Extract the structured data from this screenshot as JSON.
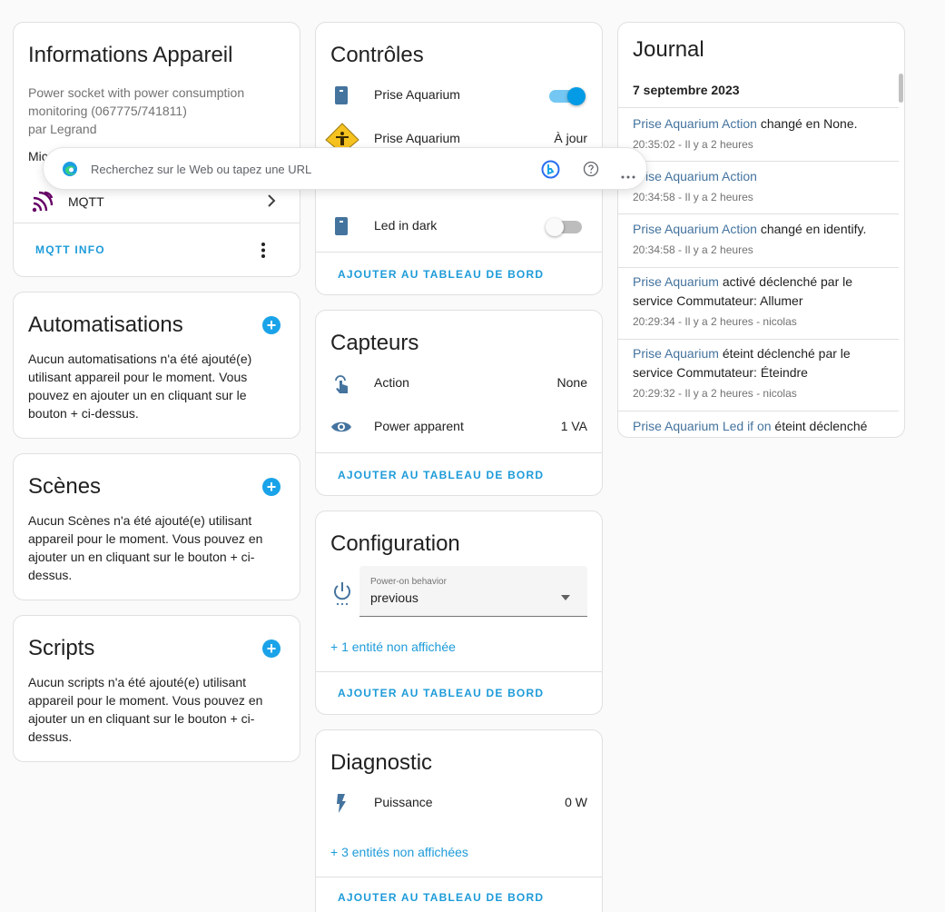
{
  "device_info": {
    "title": "Informations Appareil",
    "line1": "Power socket with power consumption",
    "line2": "monitoring (067775/741811)",
    "line3": "par Legrand",
    "partial": "Mic",
    "integration_label": "MQTT",
    "action": "MQTT INFO"
  },
  "automations": {
    "title": "Automatisations",
    "text": "Aucun automatisations n'a été ajouté(e) utilisant appareil pour le moment. Vous pouvez en ajouter un en cliquant sur le bouton + ci-dessus."
  },
  "scenes": {
    "title": "Scènes",
    "text": "Aucun Scènes n'a été ajouté(e) utilisant appareil pour le moment. Vous pouvez en ajouter un en cliquant sur le bouton + ci-dessus."
  },
  "scripts": {
    "title": "Scripts",
    "text": "Aucun scripts n'a été ajouté(e) utilisant appareil pour le moment. Vous pouvez en ajouter un en cliquant sur le bouton + ci-dessus."
  },
  "controls": {
    "title": "Contrôles",
    "rows": [
      {
        "name": "Prise Aquarium",
        "state": "on"
      },
      {
        "name": "Prise Aquarium",
        "value": "À jour"
      },
      {
        "name": "Led in dark",
        "state": "off"
      }
    ],
    "action": "AJOUTER AU TABLEAU DE BORD"
  },
  "sensors": {
    "title": "Capteurs",
    "rows": [
      {
        "name": "Action",
        "value": "None"
      },
      {
        "name": "Power apparent",
        "value": "1 VA"
      }
    ],
    "action": "AJOUTER AU TABLEAU DE BORD"
  },
  "configuration": {
    "title": "Configuration",
    "select_label": "Power-on behavior",
    "select_value": "previous",
    "hidden_link": "+ 1 entité non affichée",
    "action": "AJOUTER AU TABLEAU DE BORD"
  },
  "diagnostic": {
    "title": "Diagnostic",
    "row_name": "Puissance",
    "row_value": "0 W",
    "hidden_link": "+ 3 entités non affichées",
    "action": "AJOUTER AU TABLEAU DE BORD"
  },
  "journal": {
    "title": "Journal",
    "date": "7 septembre 2023",
    "entries": [
      {
        "entity": "Prise Aquarium Action",
        "text": " changé en None.",
        "time": "20:35:02 - Il y a 2 heures"
      },
      {
        "entity": "Prise Aquarium Action",
        "text": "",
        "time": "20:34:58 - Il y a 2 heures"
      },
      {
        "entity": "Prise Aquarium Action",
        "text": " changé en identify.",
        "time": "20:34:58 - Il y a 2 heures"
      },
      {
        "entity": "Prise Aquarium",
        "text": " activé déclenché par le service Commutateur: Allumer",
        "time": "20:29:34 - Il y a 2 heures - nicolas"
      },
      {
        "entity": "Prise Aquarium",
        "text": " éteint déclenché par le service Commutateur: Éteindre",
        "time": "20:29:32 - Il y a 2 heures - nicolas"
      },
      {
        "entity": "Prise Aquarium Led if on",
        "text": " éteint déclenché",
        "time": ""
      }
    ]
  },
  "browser_popup": {
    "placeholder": "Recherchez sur le Web ou tapez une URL"
  },
  "colors": {
    "accent": "#1d9bd9",
    "entity_link": "#44739e",
    "mqtt_purple": "#660066",
    "toggle_on": "#039be5"
  },
  "icons": {
    "mqtt": "mqtt-icon",
    "plug": "power-socket-icon",
    "update": "update-icon",
    "touch": "gesture-tap-icon",
    "eye": "eye-icon",
    "power": "power-icon",
    "flash": "flash-icon"
  }
}
